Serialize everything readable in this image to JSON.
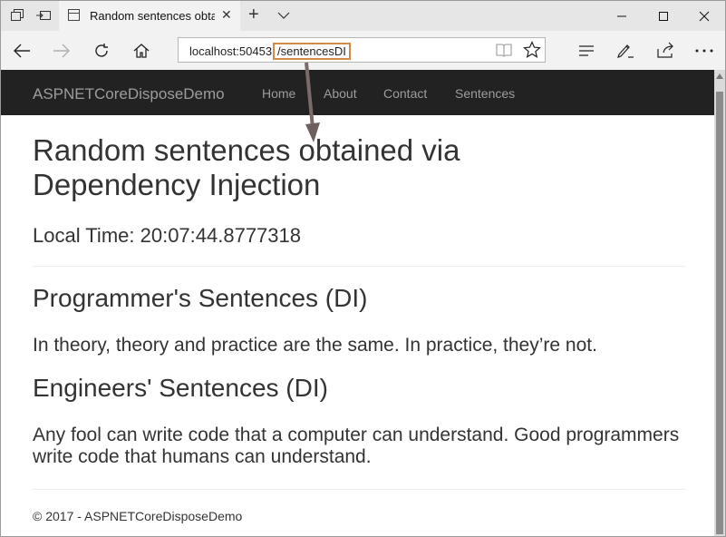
{
  "browser": {
    "tab_title": "Random sentences obtained via Dependency Injection",
    "url_host": "localhost:50453",
    "url_path": "/sentencesDI"
  },
  "site": {
    "brand": "ASPNETCoreDisposeDemo",
    "menu": [
      "Home",
      "About",
      "Contact",
      "Sentences"
    ]
  },
  "page": {
    "title": "Random sentences obtained via Dependency Injection",
    "local_time": "Local Time: 20:07:44.8777318",
    "sections": [
      {
        "heading": "Programmer's Sentences (DI)",
        "sentence": "In theory, theory and practice are the same. In practice, they’re not."
      },
      {
        "heading": "Engineers' Sentences (DI)",
        "sentence": "Any fool can write code that a computer can understand. Good programmers write code that humans can understand."
      }
    ],
    "footer": "© 2017 - ASPNETCoreDisposeDemo"
  },
  "colors": {
    "navbar_bg": "#222222",
    "navbar_text": "#9d9d9d",
    "url_highlight": "#d28a49",
    "annotation_arrow": "#7a6a6a"
  },
  "icons": [
    "tab-set-aside-icon",
    "tab-preview-icon",
    "page-icon",
    "close-icon",
    "new-tab-icon",
    "tab-list-icon",
    "minimize-icon",
    "maximize-icon",
    "close-window-icon",
    "back-icon",
    "forward-icon",
    "refresh-icon",
    "home-icon",
    "reading-view-icon",
    "favorite-star-icon",
    "hub-icon",
    "web-note-icon",
    "share-icon",
    "more-icon"
  ]
}
